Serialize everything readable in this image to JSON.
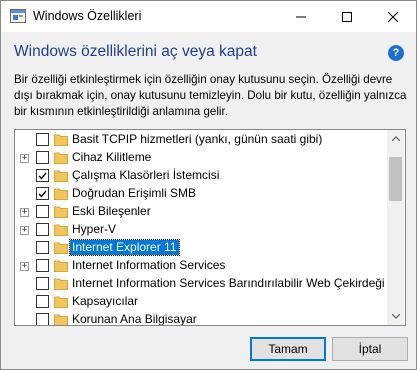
{
  "window": {
    "title": "Windows Özellikleri"
  },
  "dialog": {
    "heading": "Windows özelliklerini aç veya kapat",
    "description": "Bir özelliği etkinleştirmek için özelliğin onay kutusunu seçin. Özelliği devre dışı bırakmak için, onay kutusunu temizleyin. Dolu bir kutu, özelliğin yalnızca bir kısmının etkinleştirildiği anlamına gelir.",
    "help_icon_text": "?"
  },
  "features": [
    {
      "label": "Basit TCPIP hizmetleri (yankı, günün saati gibi)",
      "expandable": false,
      "checked": false,
      "selected": false
    },
    {
      "label": "Cihaz Kilitleme",
      "expandable": true,
      "checked": false,
      "selected": false
    },
    {
      "label": "Çalışma Klasörleri İstemcisi",
      "expandable": false,
      "checked": true,
      "selected": false
    },
    {
      "label": "Doğrudan Erişimli SMB",
      "expandable": false,
      "checked": true,
      "selected": false
    },
    {
      "label": "Eski Bileşenler",
      "expandable": true,
      "checked": false,
      "selected": false
    },
    {
      "label": "Hyper-V",
      "expandable": true,
      "checked": false,
      "selected": false
    },
    {
      "label": "Internet Explorer 11",
      "expandable": false,
      "checked": false,
      "selected": true
    },
    {
      "label": "Internet Information Services",
      "expandable": true,
      "checked": false,
      "selected": false
    },
    {
      "label": "Internet Information Services Barındırılabilir Web Çekirdeği",
      "expandable": false,
      "checked": false,
      "selected": false
    },
    {
      "label": "Kapsayıcılar",
      "expandable": false,
      "checked": false,
      "selected": false
    },
    {
      "label": "Korunan Ana Bilgisayar",
      "expandable": false,
      "checked": false,
      "selected": false
    }
  ],
  "buttons": {
    "ok": "Tamam",
    "cancel": "İptal"
  },
  "colors": {
    "heading": "#1e3f8f",
    "selection": "#0078d7",
    "folder": "#f2c55c",
    "default_button_border": "#0078d7"
  }
}
